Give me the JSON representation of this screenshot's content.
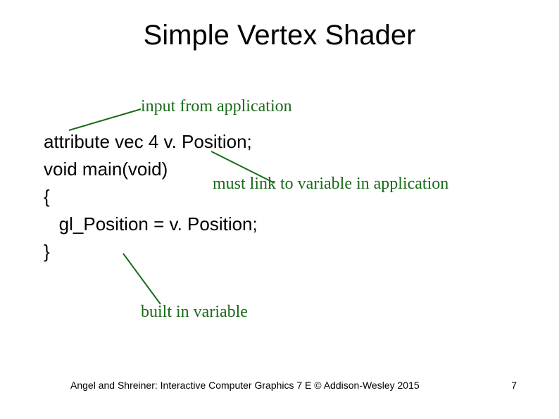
{
  "title": "Simple Vertex Shader",
  "annotations": {
    "input": "input from application",
    "link": "must link to variable in application",
    "builtin": "built in variable"
  },
  "code": {
    "l1": "attribute vec 4 v. Position;",
    "l2": "void main(void)",
    "l3": "{",
    "l4": "   gl_Position = v. Position;",
    "l5": "}"
  },
  "footer": "Angel and Shreiner: Interactive Computer Graphics 7 E © Addison-Wesley 2015",
  "page_number": "7"
}
